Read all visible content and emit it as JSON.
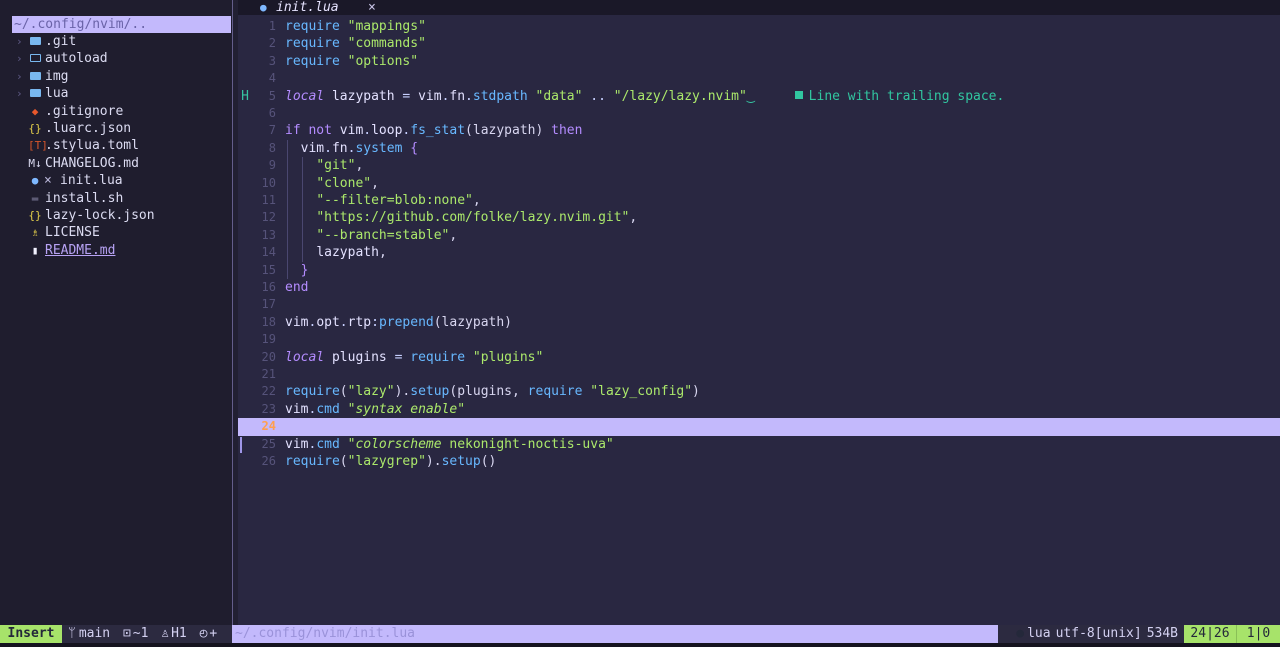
{
  "sidebar": {
    "title": "~/.config/nvim/..",
    "items": [
      {
        "chevron": "›",
        "icon": "folder-icon",
        "name": ".git"
      },
      {
        "chevron": "›",
        "icon": "folder-open-icon",
        "name": "autoload"
      },
      {
        "chevron": "›",
        "icon": "folder-icon",
        "name": "img"
      },
      {
        "chevron": "›",
        "icon": "folder-icon",
        "name": "lua"
      },
      {
        "icon": "git-icon",
        "glyph": "◆",
        "color": "#e8582c",
        "name": ".gitignore"
      },
      {
        "icon": "json-icon",
        "glyph": "{}",
        "color": "#e5d04b",
        "name": ".luarc.json"
      },
      {
        "icon": "toml-icon",
        "glyph": "[T]",
        "color": "#d8562a",
        "name": ".stylua.toml"
      },
      {
        "icon": "markdown-icon",
        "glyph": "M↓",
        "color": "#dcdcf2",
        "name": "CHANGELOG.md"
      },
      {
        "icon": "lua-icon",
        "glyph": "●",
        "color": "#7fb8ff",
        "modified": "×",
        "name": "init.lua"
      },
      {
        "icon": "shell-icon",
        "glyph": "▬",
        "color": "#5c5a74",
        "name": "install.sh"
      },
      {
        "icon": "json-icon",
        "glyph": "{}",
        "color": "#e5d04b",
        "name": "lazy-lock.json"
      },
      {
        "icon": "license-icon",
        "glyph": "♗",
        "color": "#e5d04b",
        "name": "LICENSE"
      },
      {
        "icon": "readme-icon",
        "glyph": "▮",
        "color": "#f2f2ff",
        "name": "README.md"
      }
    ]
  },
  "tab": {
    "label": "init.lua",
    "close": "×",
    "icon": "lua-icon"
  },
  "editor": {
    "current_line": 24,
    "sign_line5": "H",
    "diagnostic": "Line with trailing space.",
    "lines": [
      {
        "n": "1",
        "html": "<span class=\"fn\">require</span> <span class=\"str\">\"mappings\"</span>"
      },
      {
        "n": "2",
        "html": "<span class=\"fn\">require</span> <span class=\"str\">\"commands\"</span>"
      },
      {
        "n": "3",
        "html": "<span class=\"fn\">require</span> <span class=\"str\">\"options\"</span>"
      },
      {
        "n": "4",
        "html": ""
      },
      {
        "n": "5",
        "html": "<span class=\"kwi\">local</span> <span class=\"var\">lazypath</span> <span class=\"op\">=</span> <span class=\"var\">vim</span><span class=\"op\">.</span><span class=\"var\">fn</span><span class=\"op\">.</span><span class=\"fn\">stdpath</span> <span class=\"str\">\"data\"</span> <span class=\"op\">..</span> <span class=\"str\">\"/lazy/lazy.nvim\"</span><span class=\"tsp\">‿</span>"
      },
      {
        "n": "6",
        "html": ""
      },
      {
        "n": "7",
        "html": "<span class=\"kw\">if</span> <span class=\"kw\">not</span> <span class=\"var\">vim</span><span class=\"op\">.</span><span class=\"var\">loop</span><span class=\"op\">.</span><span class=\"fn\">fs_stat</span><span class=\"pa\">(lazypath)</span> <span class=\"kw\">then</span>"
      },
      {
        "n": "8",
        "html": "  <span class=\"var\">vim</span><span class=\"op\">.</span><span class=\"var\">fn</span><span class=\"op\">.</span><span class=\"fn\">system</span> <span class=\"kw\">{</span>"
      },
      {
        "n": "9",
        "html": "    <span class=\"str\">\"git\"</span><span class=\"pa\">,</span>"
      },
      {
        "n": "10",
        "html": "    <span class=\"str\">\"clone\"</span><span class=\"pa\">,</span>"
      },
      {
        "n": "11",
        "html": "    <span class=\"str\">\"--filter=blob:none\"</span><span class=\"pa\">,</span>"
      },
      {
        "n": "12",
        "html": "    <span class=\"str\">\"https://github.com/folke/lazy.nvim.git\"</span><span class=\"pa\">,</span>"
      },
      {
        "n": "13",
        "html": "    <span class=\"str\">\"--branch=stable\"</span><span class=\"pa\">,</span>"
      },
      {
        "n": "14",
        "html": "    <span class=\"var\">lazypath</span><span class=\"pa\">,</span>"
      },
      {
        "n": "15",
        "html": "  <span class=\"kw\">}</span>"
      },
      {
        "n": "16",
        "html": "<span class=\"kw\">end</span>"
      },
      {
        "n": "17",
        "html": ""
      },
      {
        "n": "18",
        "html": "<span class=\"var\">vim</span><span class=\"op\">.</span><span class=\"var\">opt</span><span class=\"op\">.</span><span class=\"var\">rtp</span><span class=\"op\">:</span><span class=\"fn\">prepend</span><span class=\"pa\">(lazypath)</span>"
      },
      {
        "n": "19",
        "html": ""
      },
      {
        "n": "20",
        "html": "<span class=\"kwi\">local</span> <span class=\"var\">plugins</span> <span class=\"op\">=</span> <span class=\"fn\">require</span> <span class=\"str\">\"plugins\"</span>"
      },
      {
        "n": "21",
        "html": ""
      },
      {
        "n": "22",
        "html": "<span class=\"fn\">require</span><span class=\"pa\">(</span><span class=\"str\">\"lazy\"</span><span class=\"pa\">).</span><span class=\"fn\">setup</span><span class=\"pa\">(plugins, </span><span class=\"fn\">require</span> <span class=\"str\">\"lazy_config\"</span><span class=\"pa\">)</span>"
      },
      {
        "n": "23",
        "html": "<span class=\"var\">vim</span><span class=\"op\">.</span><span class=\"fn\">cmd</span> <span class=\"stri\">\"syntax enable\"</span>"
      },
      {
        "n": "24",
        "html": ""
      },
      {
        "n": "25",
        "html": "<span class=\"var\">vim</span><span class=\"op\">.</span><span class=\"fn\">cmd</span> <span class=\"stri\">\"colorscheme</span> <span class=\"str\">nekonight-noctis-uva\"</span>"
      },
      {
        "n": "26",
        "html": "<span class=\"fn\">require</span><span class=\"pa\">(</span><span class=\"str\">\"lazygrep\"</span><span class=\"pa\">).</span><span class=\"fn\">setup</span><span class=\"pa\">()</span>"
      }
    ]
  },
  "statusline": {
    "mode": "Insert",
    "branch": "main",
    "branch_icon": "git-branch-icon",
    "changes": "~1",
    "lsp": "H1",
    "extra": "+",
    "filepath": "~/.config/nvim/init.lua",
    "filetype": "lua",
    "encoding": "utf-8[unix]",
    "size": "534B",
    "position": "24|26",
    "selection": "1|0"
  },
  "colors": {
    "background": "#292741",
    "sidebar": "#1f1d2e",
    "accent": "#c3b9fc",
    "mode": "#a7e36a"
  }
}
